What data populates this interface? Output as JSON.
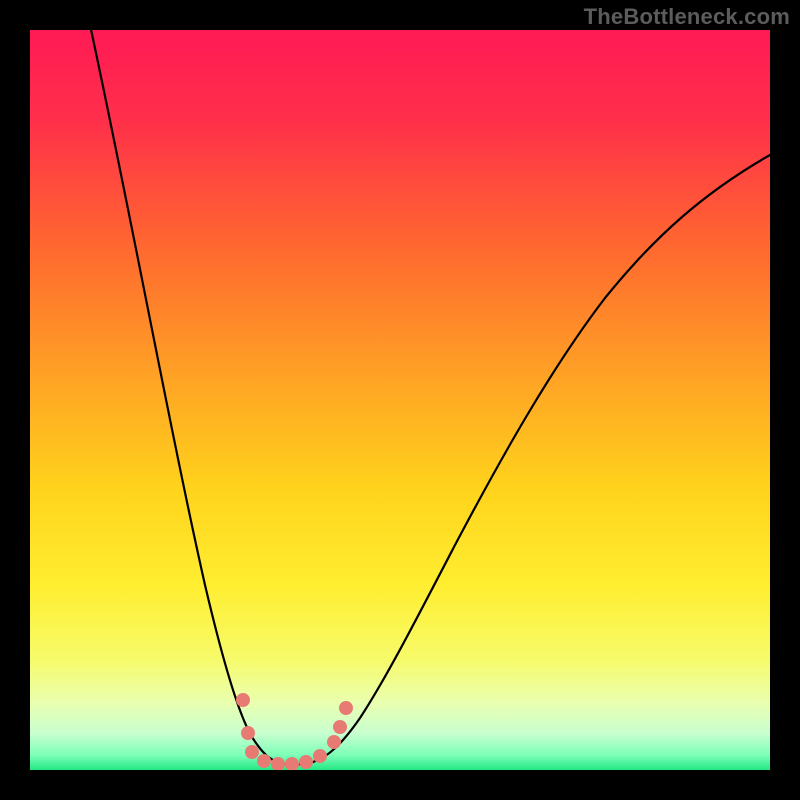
{
  "watermark": "TheBottleneck.com",
  "colors": {
    "background_frame": "#000000",
    "gradient_top": "#ff1a55",
    "gradient_mid_upper": "#ff6a2f",
    "gradient_mid": "#ffd31c",
    "gradient_mid_lower": "#f7fb6a",
    "gradient_bottom": "#22e884",
    "curve_stroke": "#000000",
    "marker_fill": "#e77b74",
    "watermark_text": "#5c5c5c"
  },
  "chart_data": {
    "type": "line",
    "title": "",
    "xlabel": "",
    "ylabel": "",
    "xlim": [
      0,
      100
    ],
    "ylim": [
      0,
      100
    ],
    "grid": false,
    "legend": false,
    "series": [
      {
        "name": "bottleneck-curve",
        "x": [
          8,
          12,
          16,
          20,
          24,
          26,
          28,
          30,
          32,
          34,
          36,
          38,
          40,
          42,
          44,
          48,
          52,
          56,
          62,
          70,
          80,
          90,
          100
        ],
        "y": [
          100,
          80,
          60,
          42,
          25,
          17,
          10,
          5,
          2,
          1,
          0.5,
          0.5,
          1,
          2,
          5,
          12,
          20,
          30,
          42,
          58,
          72,
          80,
          83
        ]
      }
    ],
    "markers": {
      "name": "highlighted-points",
      "color": "#e77b74",
      "x": [
        28.8,
        29.5,
        30.0,
        31.6,
        33.5,
        35.4,
        37.3,
        39.2,
        41.1,
        41.9,
        42.7
      ],
      "y": [
        9.5,
        5.0,
        2.4,
        1.2,
        0.8,
        0.8,
        1.1,
        1.9,
        3.8,
        5.8,
        8.4
      ]
    },
    "annotations": [
      {
        "text": "TheBottleneck.com",
        "position": "top-right"
      }
    ]
  }
}
